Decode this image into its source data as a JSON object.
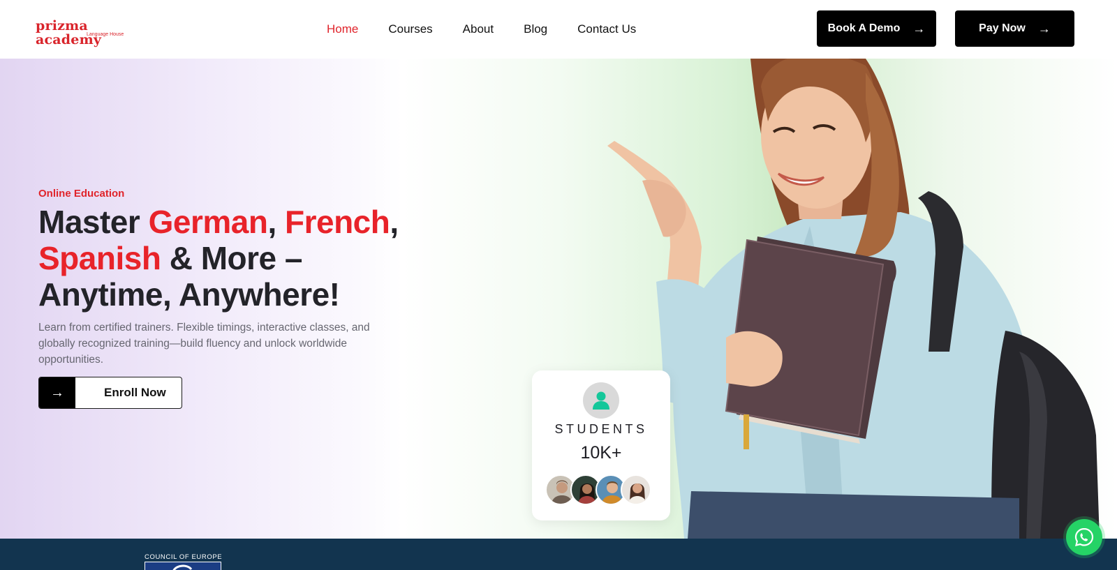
{
  "header": {
    "logo": {
      "name": "prizma academy",
      "tagline": "Language House"
    },
    "nav": [
      {
        "label": "Home",
        "active": true
      },
      {
        "label": "Courses",
        "active": false
      },
      {
        "label": "About",
        "active": false
      },
      {
        "label": "Blog",
        "active": false
      },
      {
        "label": "Contact Us",
        "active": false
      }
    ],
    "book_demo_label": "Book A Demo",
    "pay_now_label": "Pay Now",
    "arrow_icon": "arrow-right-icon"
  },
  "hero": {
    "eyebrow": "Online Education",
    "headline": {
      "part1": "Master ",
      "lang1": "German",
      "sep1": ", ",
      "lang2": "French",
      "sep2": ",",
      "lang3": "Spanish",
      "part2": " & More –",
      "part3": "Anytime, Anywhere!"
    },
    "subtext": "Learn from certified trainers. Flexible timings, interactive classes, and globally recognized training—build fluency and unlock worldwide opportunities.",
    "enroll_label": "Enroll Now"
  },
  "stats_card": {
    "icon": "user-icon",
    "title": "STUDENTS",
    "value": "10K+"
  },
  "footer_band": {
    "partner_text": "COUNCIL OF EUROPE"
  },
  "colors": {
    "accent": "#e8232a",
    "dark": "#000000",
    "band": "#12344f",
    "whatsapp": "#25d366",
    "card_icon": "#14c79a"
  }
}
